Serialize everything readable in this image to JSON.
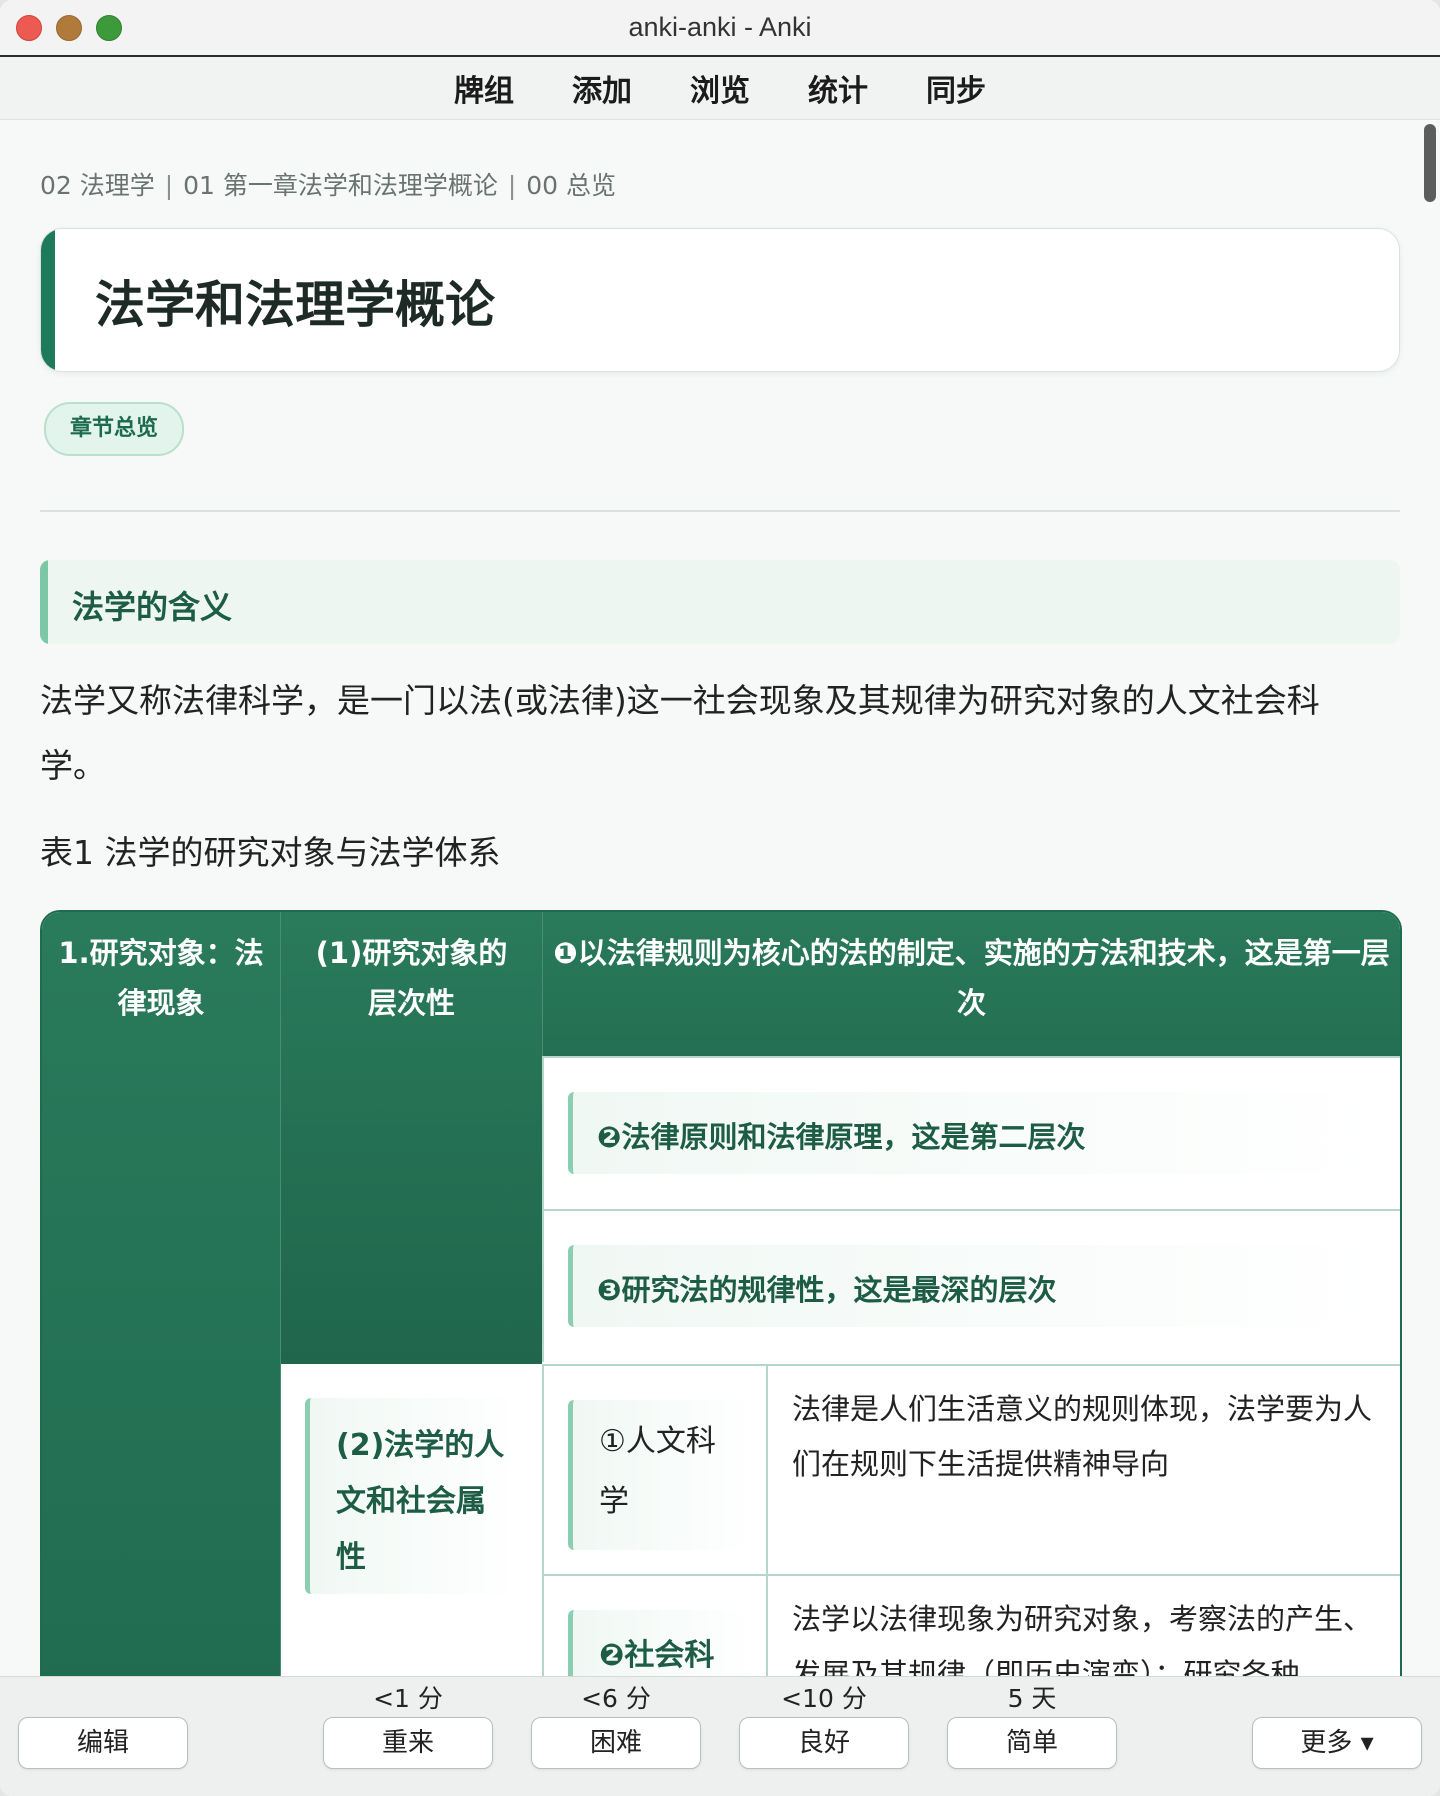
{
  "window": {
    "title": "anki-anki - Anki"
  },
  "menu": {
    "items": [
      "牌组",
      "添加",
      "浏览",
      "统计",
      "同步"
    ]
  },
  "breadcrumb": {
    "parts": [
      "02 法理学",
      "01 第一章法学和法理学概论",
      "00 总览"
    ],
    "separator": "|"
  },
  "card": {
    "title": "法学和法理学概论",
    "tag": "章节总览",
    "section_title": "法学的含义",
    "paragraph": "法学又称法律科学，是一门以法(或法律)这一社会现象及其规律为研究对象的人文社会科学。",
    "table_caption": "表1 法学的研究对象与法学体系"
  },
  "table": {
    "col1": "1.研究对象：法律现象",
    "col2_top": "(1)研究对象的层次性",
    "level1": "❶以法律规则为核心的法的制定、实施的方法和技术，这是第一层次",
    "level2": "❷法律原则和法律原理，这是第二层次",
    "level3": "❸研究法的规律性，这是最深的层次",
    "col2_bottom": "(2)法学的人文和社会属性",
    "attr1_name": "①人文科学",
    "attr1_desc": "法律是人们生活意义的规则体现，法学要为人们在规则下生活提供精神导向",
    "attr2_name": "❷社会科",
    "attr2_desc": "法学以法律现象为研究对象，考察法的产生、发展及其规律（即历史演变）；研究各种"
  },
  "answer": {
    "edit": "编辑",
    "more": "更多 ▾",
    "buttons": [
      {
        "interval": "<1 分",
        "label": "重来"
      },
      {
        "interval": "<6 分",
        "label": "困难"
      },
      {
        "interval": "<10 分",
        "label": "良好"
      },
      {
        "interval": "5 天",
        "label": "简单"
      }
    ]
  },
  "colors": {
    "accent": "#1d7a5a",
    "header_green": "#2a7a5c",
    "light_green": "#e3f4ec"
  }
}
